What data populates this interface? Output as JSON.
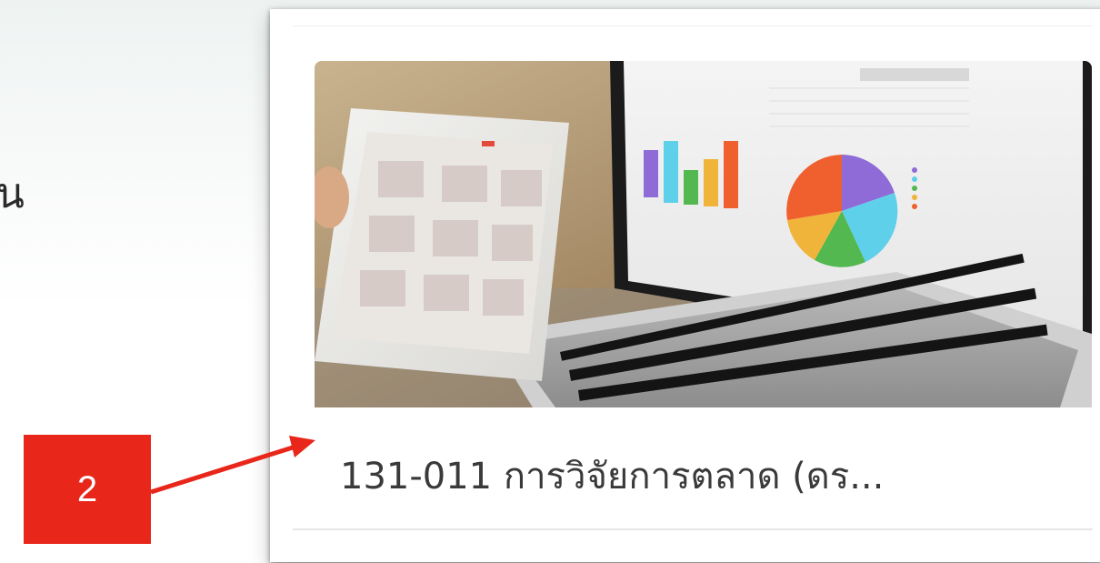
{
  "background": {
    "partial_text": "ขึ้น"
  },
  "card": {
    "title": "131-011 การวิจัยการตลาด (ดร...",
    "image_description_icon": "laptop-charts-image"
  },
  "annotation": {
    "badge_label": "2",
    "color": "#e8261a"
  }
}
